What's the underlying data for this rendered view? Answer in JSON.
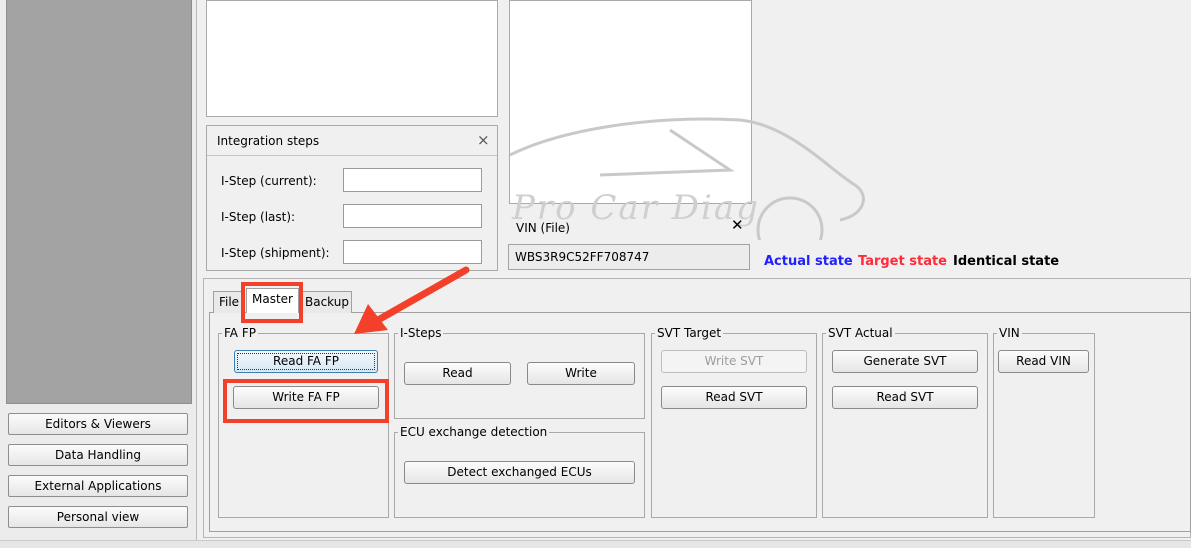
{
  "sidebar": {
    "items": [
      {
        "label": "Editors & Viewers"
      },
      {
        "label": "Data Handling"
      },
      {
        "label": "External Applications"
      },
      {
        "label": "Personal view"
      }
    ]
  },
  "integration_steps": {
    "title": "Integration steps",
    "close": "×",
    "fields": [
      {
        "label": "I-Step (current):",
        "value": ""
      },
      {
        "label": "I-Step (last):",
        "value": ""
      },
      {
        "label": "I-Step (shipment):",
        "value": ""
      }
    ]
  },
  "vin_file": {
    "title": "VIN (File)",
    "close": "✕",
    "value": "WBS3R9C52FF708747"
  },
  "watermark": "Pro Car Diag",
  "legend_states": {
    "actual": {
      "label": "Actual state",
      "color": "#1f1fff"
    },
    "target": {
      "label": "Target state",
      "color": "#ff2a3a"
    },
    "identical": {
      "label": "Identical state",
      "color": "#000000"
    }
  },
  "tabs": [
    {
      "label": "File",
      "active": false
    },
    {
      "label": "Master",
      "active": true
    },
    {
      "label": "Backup",
      "active": false
    }
  ],
  "groups": {
    "fa_fp": {
      "title": "FA FP",
      "buttons": [
        "Read FA FP",
        "Write FA FP"
      ]
    },
    "i_steps": {
      "title": "I-Steps",
      "buttons": [
        "Read",
        "Write"
      ]
    },
    "ecu_exchange": {
      "title": "ECU exchange detection",
      "buttons": [
        "Detect exchanged ECUs"
      ]
    },
    "svt_target": {
      "title": "SVT Target",
      "buttons": [
        "Write SVT",
        "Read SVT"
      ]
    },
    "svt_actual": {
      "title": "SVT Actual",
      "buttons": [
        "Generate SVT",
        "Read SVT"
      ]
    },
    "vin": {
      "title": "VIN",
      "buttons": [
        "Read VIN"
      ]
    }
  },
  "colors": {
    "annotation": "#f3402b"
  }
}
